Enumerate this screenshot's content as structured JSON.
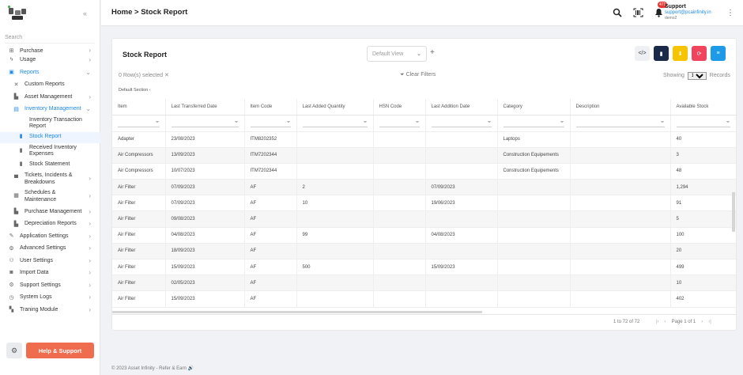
{
  "sidebar": {
    "search_placeholder": "Search",
    "items": [
      {
        "label": "Purchase",
        "icon": "cart-icon",
        "chevron": "›"
      },
      {
        "label": "Usage",
        "icon": "bolt-icon",
        "chevron": "›"
      },
      {
        "label": "Reports",
        "icon": "report-icon",
        "chevron": "⌄"
      },
      {
        "label": "Custom Reports",
        "icon": "tools-icon"
      },
      {
        "label": "Asset Management",
        "icon": "asset-icon",
        "chevron": "›"
      },
      {
        "label": "Inventory Management",
        "icon": "inventory-icon",
        "chevron": "⌄"
      },
      {
        "label": "Inventory Transaction Report"
      },
      {
        "label": "Stock Report",
        "icon": "doc-icon"
      },
      {
        "label": "Received Inventory Expenses"
      },
      {
        "label": "Stock Statement"
      },
      {
        "label": "Tickets, Incidents & Breakdowns",
        "icon": "ticket-icon",
        "chevron": "›"
      },
      {
        "label": "Schedules & Maintenance",
        "icon": "schedule-icon",
        "chevron": "›"
      },
      {
        "label": "Purchase Management",
        "icon": "purchase-icon",
        "chevron": "›"
      },
      {
        "label": "Depreciation Reports",
        "icon": "depreciation-icon",
        "chevron": "›"
      },
      {
        "label": "Application Settings",
        "icon": "wrench-icon",
        "chevron": "›"
      },
      {
        "label": "Advanced Settings",
        "icon": "gears-icon",
        "chevron": "›"
      },
      {
        "label": "User Settings",
        "icon": "users-icon",
        "chevron": "›"
      },
      {
        "label": "Import Data",
        "icon": "database-icon",
        "chevron": "›"
      },
      {
        "label": "Support Settings",
        "icon": "support-icon",
        "chevron": "›"
      },
      {
        "label": "System Logs",
        "icon": "logs-icon",
        "chevron": "›"
      },
      {
        "label": "Traning Module",
        "icon": "training-icon",
        "chevron": "›"
      }
    ],
    "help_label": "Help & Support"
  },
  "header": {
    "breadcrumb": "Home > Stock Report",
    "notification_count": "471",
    "user_name": "Support",
    "user_email": "support@pcainfinity.in",
    "user_domain": "demo2"
  },
  "panel": {
    "title": "Stock Report",
    "view_select": "Default View",
    "rows_selected": "0 Row(s) selected",
    "clear_filters": "Clear Filters",
    "showing_prefix": "Showing",
    "showing_value": "100",
    "showing_suffix": "Records",
    "section_label": "Default Section",
    "buttons": [
      {
        "name": "code-icon",
        "color": "#eef0f3",
        "glyph": "</>"
      },
      {
        "name": "pdf-icon",
        "color": "#1b2a4a",
        "glyph": "▮"
      },
      {
        "name": "download-icon",
        "color": "#f7c400",
        "glyph": "⬇"
      },
      {
        "name": "refresh-icon",
        "color": "#f0445c",
        "glyph": "⟳"
      },
      {
        "name": "settings-sliders-icon",
        "color": "#1e9be8",
        "glyph": "≡"
      }
    ]
  },
  "table": {
    "columns": [
      "Item",
      "Last Transferred Date",
      "Item Code",
      "Last Added Quantity",
      "HSN Code",
      "Last Addition Date",
      "Category",
      "Description",
      "Available Stock"
    ],
    "rows": [
      [
        "Adapter",
        "23/08/2023",
        "ITM8202352",
        "",
        "",
        "",
        "Laptops",
        "",
        "40"
      ],
      [
        "Air Compressors",
        "13/09/2023",
        "ITM7202344",
        "",
        "",
        "",
        "Construction Equipements",
        "",
        "3"
      ],
      [
        "Air Compressors",
        "10/07/2023",
        "ITM7202344",
        "",
        "",
        "",
        "Construction Equipements",
        "",
        "48"
      ],
      [
        "Air Filter",
        "07/09/2023",
        "AF",
        "2",
        "",
        "07/09/2023",
        "",
        "",
        "1,294"
      ],
      [
        "Air Filter",
        "07/09/2023",
        "AF",
        "10",
        "",
        "19/06/2023",
        "",
        "",
        "91"
      ],
      [
        "Air Filter",
        "09/08/2023",
        "AF",
        "",
        "",
        "",
        "",
        "",
        "5"
      ],
      [
        "Air Filter",
        "04/08/2023",
        "AF",
        "99",
        "",
        "04/08/2023",
        "",
        "",
        "100"
      ],
      [
        "Air Filter",
        "18/09/2023",
        "AF",
        "",
        "",
        "",
        "",
        "",
        "20"
      ],
      [
        "Air Filter",
        "15/09/2023",
        "AF",
        "500",
        "",
        "15/09/2023",
        "",
        "",
        "499"
      ],
      [
        "Air Filter",
        "02/05/2023",
        "AF",
        "",
        "",
        "",
        "",
        "",
        "10"
      ],
      [
        "Air Filter",
        "15/09/2023",
        "AF",
        "",
        "",
        "",
        "",
        "",
        "402"
      ]
    ],
    "paging_text": "1 to 72 of 72",
    "page_text": "Page 1 of 1"
  },
  "footer": {
    "copyright": "© 2023  Asset Infinity - Refer & Earn 🔊"
  }
}
